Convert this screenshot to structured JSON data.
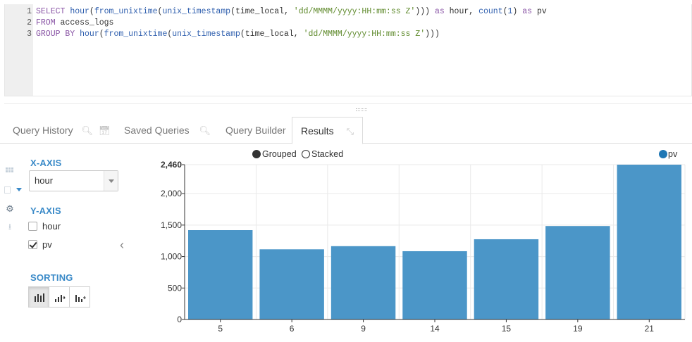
{
  "editor": {
    "lines": [
      {
        "num": "1",
        "tokens": [
          {
            "t": "SELECT ",
            "c": "kw"
          },
          {
            "t": "hour",
            "c": "fn"
          },
          {
            "t": "(",
            "c": "plain"
          },
          {
            "t": "from_unixtime",
            "c": "fn"
          },
          {
            "t": "(",
            "c": "plain"
          },
          {
            "t": "unix_timestamp",
            "c": "fn"
          },
          {
            "t": "(time_local, ",
            "c": "plain"
          },
          {
            "t": "'dd/MMMM/yyyy:HH:mm:ss Z'",
            "c": "str"
          },
          {
            "t": "))) ",
            "c": "plain"
          },
          {
            "t": "as ",
            "c": "kw"
          },
          {
            "t": "hour, ",
            "c": "plain"
          },
          {
            "t": "count",
            "c": "fn"
          },
          {
            "t": "(",
            "c": "plain"
          },
          {
            "t": "1",
            "c": "num"
          },
          {
            "t": ") ",
            "c": "plain"
          },
          {
            "t": "as ",
            "c": "kw"
          },
          {
            "t": "pv",
            "c": "plain"
          }
        ]
      },
      {
        "num": "2",
        "tokens": [
          {
            "t": "FROM ",
            "c": "kw"
          },
          {
            "t": "access_logs",
            "c": "plain"
          }
        ]
      },
      {
        "num": "3",
        "tokens": [
          {
            "t": "GROUP BY ",
            "c": "kw"
          },
          {
            "t": "hour",
            "c": "fn"
          },
          {
            "t": "(",
            "c": "plain"
          },
          {
            "t": "from_unixtime",
            "c": "fn"
          },
          {
            "t": "(",
            "c": "plain"
          },
          {
            "t": "unix_timestamp",
            "c": "fn"
          },
          {
            "t": "(time_local, ",
            "c": "plain"
          },
          {
            "t": "'dd/MMMM/yyyy:HH:mm:ss Z'",
            "c": "str"
          },
          {
            "t": ")))",
            "c": "plain"
          }
        ]
      }
    ],
    "top_cut_text": "",
    "top_cut_link": ""
  },
  "tabs": {
    "query_history": "Query History",
    "saved_queries": "Saved Queries",
    "query_builder": "Query Builder",
    "results": "Results"
  },
  "settings": {
    "x_axis_title": "X-AXIS",
    "x_axis_selected": "hour",
    "y_axis_title": "Y-AXIS",
    "y_axis_options": [
      {
        "label": "hour",
        "checked": false
      },
      {
        "label": "pv",
        "checked": true
      }
    ],
    "sorting_title": "SORTING"
  },
  "chart_mode": {
    "grouped": "Grouped",
    "stacked": "Stacked",
    "selected": "grouped"
  },
  "chart_data": {
    "type": "bar",
    "categories": [
      "5",
      "6",
      "9",
      "14",
      "15",
      "19",
      "21"
    ],
    "series": [
      {
        "name": "pv",
        "color": "#1f77b4",
        "values": [
          1420,
          1115,
          1165,
          1085,
          1275,
          1485,
          2460
        ]
      }
    ],
    "y_ticks": [
      0,
      500,
      1000,
      1500,
      2000,
      2460
    ],
    "y_tick_labels": [
      "0",
      "500",
      "1,000",
      "1,500",
      "2,000",
      "2,460"
    ],
    "ylim": [
      0,
      2460
    ],
    "grid": true,
    "legend": "top-right",
    "bar_color": "#4b96c8"
  }
}
